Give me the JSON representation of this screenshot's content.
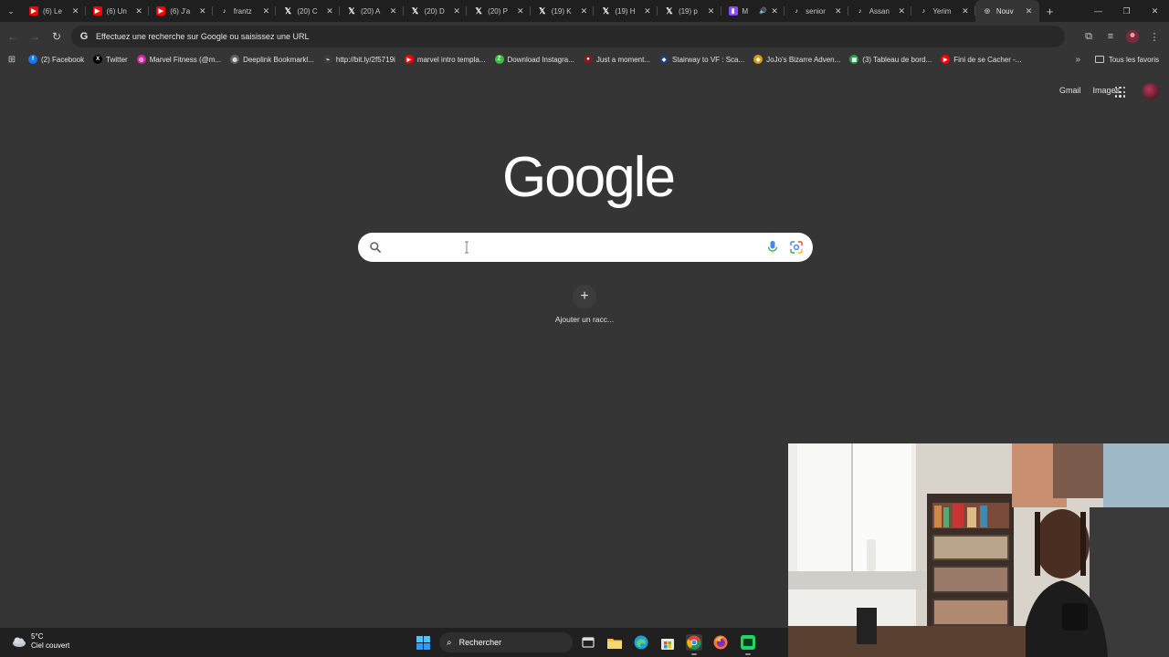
{
  "tabs": [
    {
      "title": "(6) Le",
      "favicon": "youtube-icon"
    },
    {
      "title": "(6) Un",
      "favicon": "youtube-icon"
    },
    {
      "title": "(6) J'a",
      "favicon": "youtube-icon"
    },
    {
      "title": "frantz",
      "favicon": "tiktok-icon"
    },
    {
      "title": "(20) C",
      "favicon": "x-icon"
    },
    {
      "title": "(20) A",
      "favicon": "x-icon"
    },
    {
      "title": "(20) D",
      "favicon": "x-icon"
    },
    {
      "title": "(20) P",
      "favicon": "x-icon"
    },
    {
      "title": "(19) K",
      "favicon": "x-icon"
    },
    {
      "title": "(19) H",
      "favicon": "x-icon"
    },
    {
      "title": "(19) p",
      "favicon": "x-icon"
    },
    {
      "title": "M",
      "favicon": "twitch-icon"
    },
    {
      "title": "senior",
      "favicon": "tiktok-icon"
    },
    {
      "title": "Assan",
      "favicon": "tiktok-icon"
    },
    {
      "title": "Yerim",
      "favicon": "tiktok-icon"
    },
    {
      "title": "Nouv",
      "favicon": "globe-icon",
      "active": true
    }
  ],
  "omnibox": {
    "placeholder": "Effectuez une recherche sur Google ou saisissez une URL"
  },
  "bookmarks": [
    {
      "label": "(2) Facebook",
      "color": "#1877f2",
      "glyph": "f"
    },
    {
      "label": "Twitter",
      "color": "#000000",
      "glyph": "X"
    },
    {
      "label": "Marvel Fitness (@m...",
      "color": "#d6249f",
      "glyph": "◎"
    },
    {
      "label": "Deeplink Bookmarkl...",
      "color": "#5f6368",
      "glyph": "◍"
    },
    {
      "label": "http://bit.ly/2f5719i",
      "color": "#3c3c3c",
      "glyph": "⌁"
    },
    {
      "label": "marvel intro templa...",
      "color": "#ff0000",
      "glyph": "▶"
    },
    {
      "label": "Download Instagra...",
      "color": "#3fbf3f",
      "glyph": "Z"
    },
    {
      "label": "Just a moment...",
      "color": "#7a1f1f",
      "glyph": "●"
    },
    {
      "label": "Stairway to VF : Sca...",
      "color": "#1f3f7a",
      "glyph": "◆"
    },
    {
      "label": "JoJo's Bizarre Adven...",
      "color": "#d4a017",
      "glyph": "◆"
    },
    {
      "label": "(3) Tableau de bord...",
      "color": "#2a9d4a",
      "glyph": "▣"
    },
    {
      "label": "Fini de se Cacher -...",
      "color": "#ff0000",
      "glyph": "▶"
    }
  ],
  "bookmarks_all": "Tous les favoris",
  "ntp": {
    "gmail": "Gmail",
    "images": "Images",
    "logo": "Google",
    "add_shortcut": "Ajouter un racc..."
  },
  "taskbar": {
    "temperature": "5°C",
    "weather": "Ciel couvert",
    "search": "Rechercher"
  }
}
